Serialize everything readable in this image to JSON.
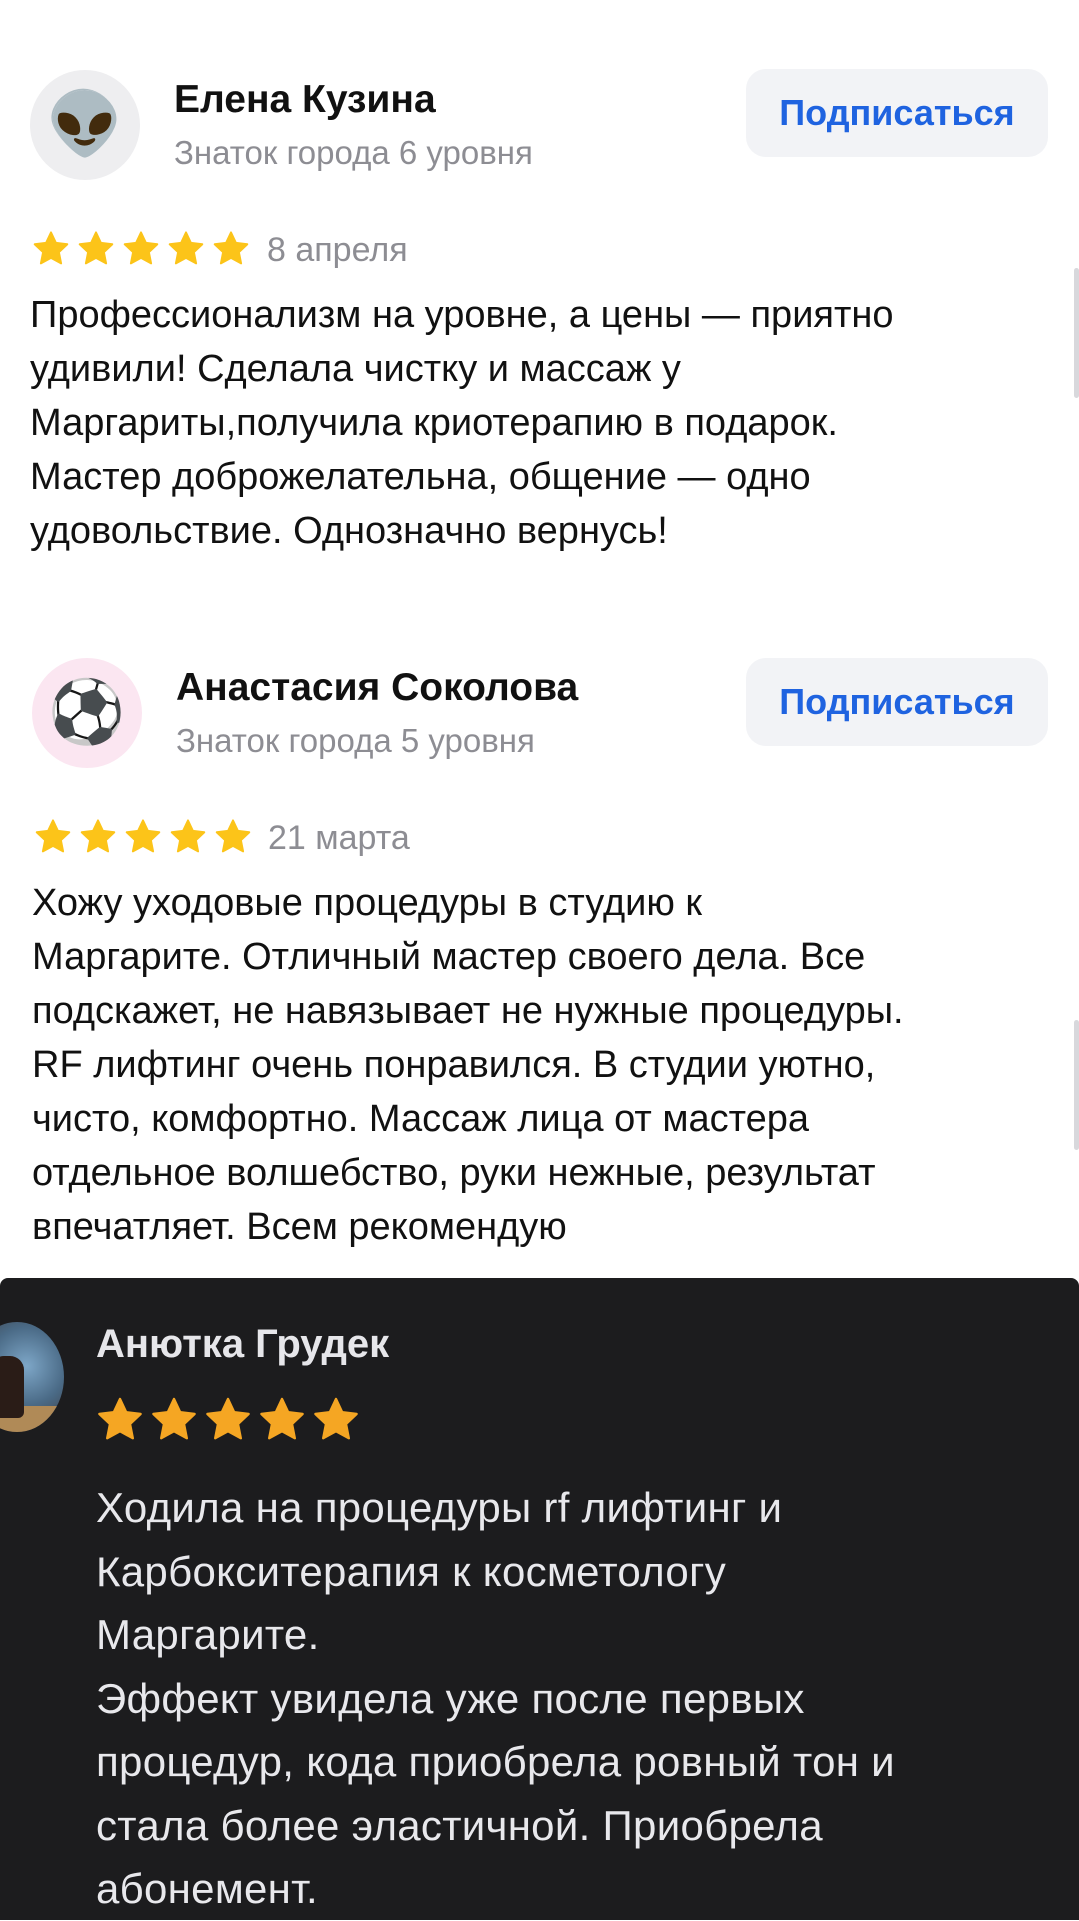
{
  "reviews": [
    {
      "author": "Елена Кузина",
      "level": "Знаток города 6 уровня",
      "avatar_icon": "alien-icon",
      "avatar_glyph": "👽",
      "subscribe_label": "Подписаться",
      "rating": 5,
      "date": "8 апреля",
      "text": "Профессионализм на уровне, а цены — приятно\nудивили! Сделала чистку и массаж у\nМаргариты,получила криотерапию в подарок.\nМастер доброжелательна, общение — одно\nудовольствие. Однозначно вернусь!"
    },
    {
      "author": "Анастасия Соколова",
      "level": "Знаток города 5 уровня",
      "avatar_icon": "soccer-ball-icon",
      "avatar_glyph": "⚽",
      "subscribe_label": "Подписаться",
      "rating": 5,
      "date": "21 марта",
      "text": "Хожу уходовые процедуры в студию к\nМаргарите.  Отличный мастер своего дела. Все\nподскажет, не навязывает не нужные процедуры.\nRF лифтинг очень понравился. В студии уютно,\nчисто, комфортно. Массаж лица от мастера\nотдельное волшебство, руки нежные, результат\nвпечатляет. Всем рекомендую"
    }
  ],
  "embedded_review": {
    "author": "Анютка Грудек",
    "rating": 5,
    "text": "Ходила на процедуры rf лифтинг и\nКарбокситерапия к косметологу\nМаргарите.\nЭффект увидела уже после первых\nпроцедур, кода приобрела ровный тон и\nстала более эластичной. Приобрела\nабонемент."
  },
  "colors": {
    "star": "#fcc419",
    "star_dark": "#f5a623",
    "accent": "#1f63e0",
    "secondary_text": "#8d8d93",
    "button_bg": "#f2f3f6",
    "dark_bg": "#1c1c1e"
  }
}
